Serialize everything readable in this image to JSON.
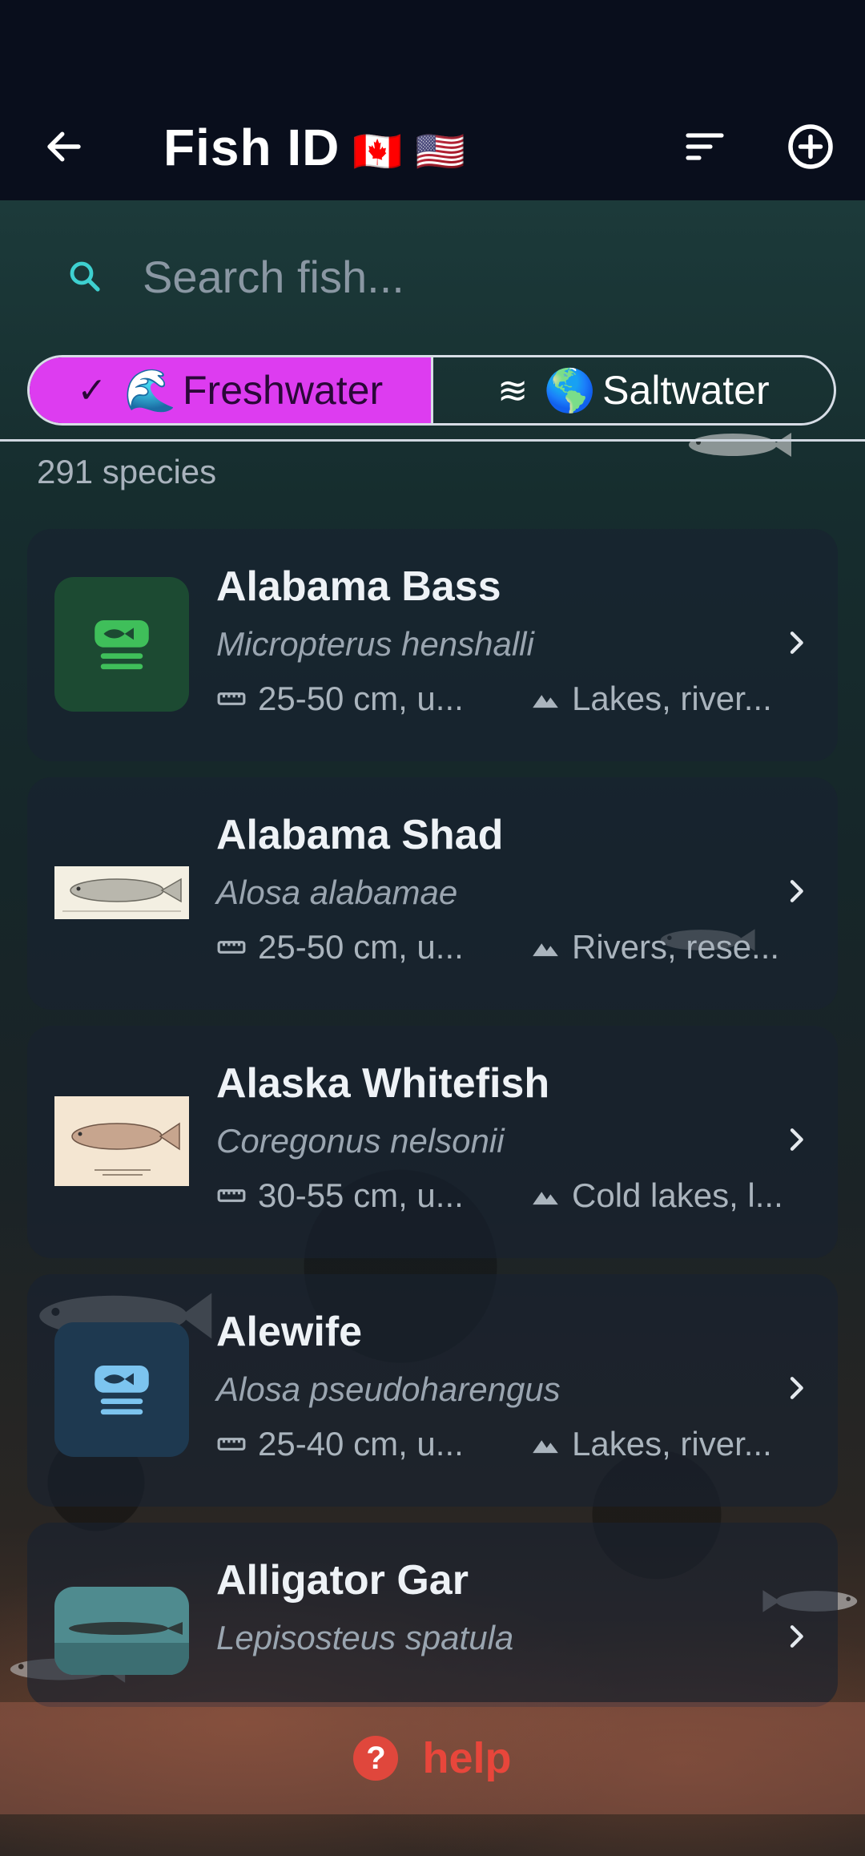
{
  "app": {
    "title": "Fish ID",
    "flags": "🇨🇦 🇺🇸"
  },
  "search": {
    "placeholder": "Search fish..."
  },
  "filters": {
    "freshwater": {
      "check": "✓",
      "emoji": "🌊",
      "label": "Freshwater",
      "selected": true
    },
    "saltwater": {
      "waves": "≋",
      "emoji": "🌎",
      "label": "Saltwater",
      "selected": false
    },
    "accent_color": "#dd3cf0"
  },
  "species_count": "291 species",
  "fish": [
    {
      "name": "Alabama Bass",
      "scientific": "Micropterus henshalli",
      "size": "25-50 cm, u...",
      "habitat": "Lakes, river...",
      "thumb": "fish-icon-green"
    },
    {
      "name": "Alabama Shad",
      "scientific": "Alosa alabamae",
      "size": "25-50 cm, u...",
      "habitat": "Rivers, rese...",
      "thumb": "illustration"
    },
    {
      "name": "Alaska Whitefish",
      "scientific": "Coregonus nelsonii",
      "size": "30-55 cm, u...",
      "habitat": "Cold lakes, l...",
      "thumb": "illustration"
    },
    {
      "name": "Alewife",
      "scientific": "Alosa pseudoharengus",
      "size": "25-40 cm, u...",
      "habitat": "Lakes, river...",
      "thumb": "fish-icon-blue"
    },
    {
      "name": "Alligator Gar",
      "scientific": "Lepisosteus spatula",
      "size": "",
      "habitat": "",
      "thumb": "photo"
    }
  ],
  "help": {
    "icon": "?",
    "label": "help",
    "color": "#e8463b"
  }
}
